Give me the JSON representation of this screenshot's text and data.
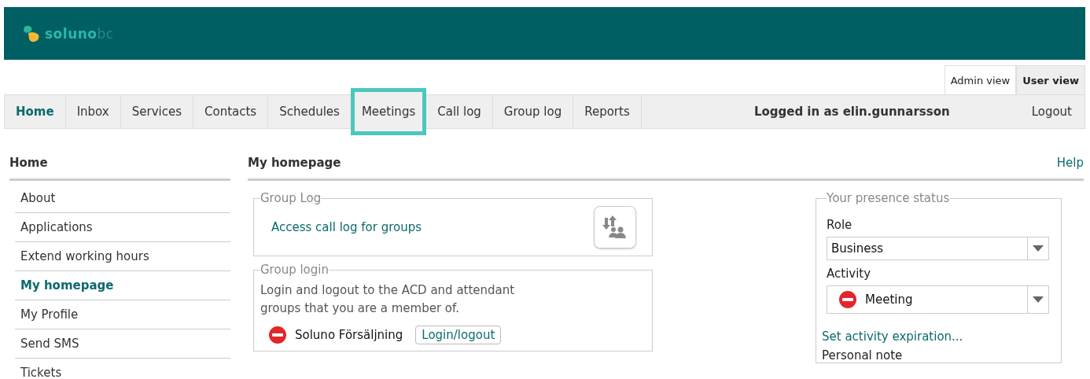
{
  "header": {
    "logo": {
      "name": "soluno",
      "suffix": "bc"
    }
  },
  "view_switch": [
    {
      "label": "Admin view",
      "selected": false
    },
    {
      "label": "User view",
      "selected": true
    }
  ],
  "tabs": [
    {
      "label": "Home",
      "selected": true,
      "highlighted": false
    },
    {
      "label": "Inbox",
      "selected": false,
      "highlighted": false
    },
    {
      "label": "Services",
      "selected": false,
      "highlighted": false
    },
    {
      "label": "Contacts",
      "selected": false,
      "highlighted": false
    },
    {
      "label": "Schedules",
      "selected": false,
      "highlighted": false
    },
    {
      "label": "Meetings",
      "selected": false,
      "highlighted": true
    },
    {
      "label": "Call log",
      "selected": false,
      "highlighted": false
    },
    {
      "label": "Group log",
      "selected": false,
      "highlighted": false
    },
    {
      "label": "Reports",
      "selected": false,
      "highlighted": false
    }
  ],
  "user": {
    "logged_in": "Logged in as elin.gunnarsson",
    "logout": "Logout"
  },
  "sidebar": {
    "title": "Home",
    "items": [
      {
        "label": "About",
        "selected": false
      },
      {
        "label": "Applications",
        "selected": false
      },
      {
        "label": "Extend working hours",
        "selected": false
      },
      {
        "label": "My homepage",
        "selected": true
      },
      {
        "label": "My Profile",
        "selected": false
      },
      {
        "label": "Send SMS",
        "selected": false
      },
      {
        "label": "Tickets",
        "selected": false
      }
    ]
  },
  "main": {
    "title": "My homepage",
    "help": "Help",
    "group_log": {
      "legend": "Group Log",
      "link": "Access call log for groups"
    },
    "group_login": {
      "legend": "Group login",
      "description": "Login and logout to the ACD and attendant groups that you are a member of.",
      "groups": [
        {
          "name": "Soluno Försäljning",
          "logged_in": false,
          "button": "Login/logout"
        }
      ]
    },
    "presence": {
      "legend": "Your presence status",
      "role_label": "Role",
      "role": "Business",
      "activity_label": "Activity",
      "activity": "Meeting",
      "activity_busy": true,
      "expiration_link": "Set activity expiration...",
      "note_label": "Personal note"
    }
  }
}
